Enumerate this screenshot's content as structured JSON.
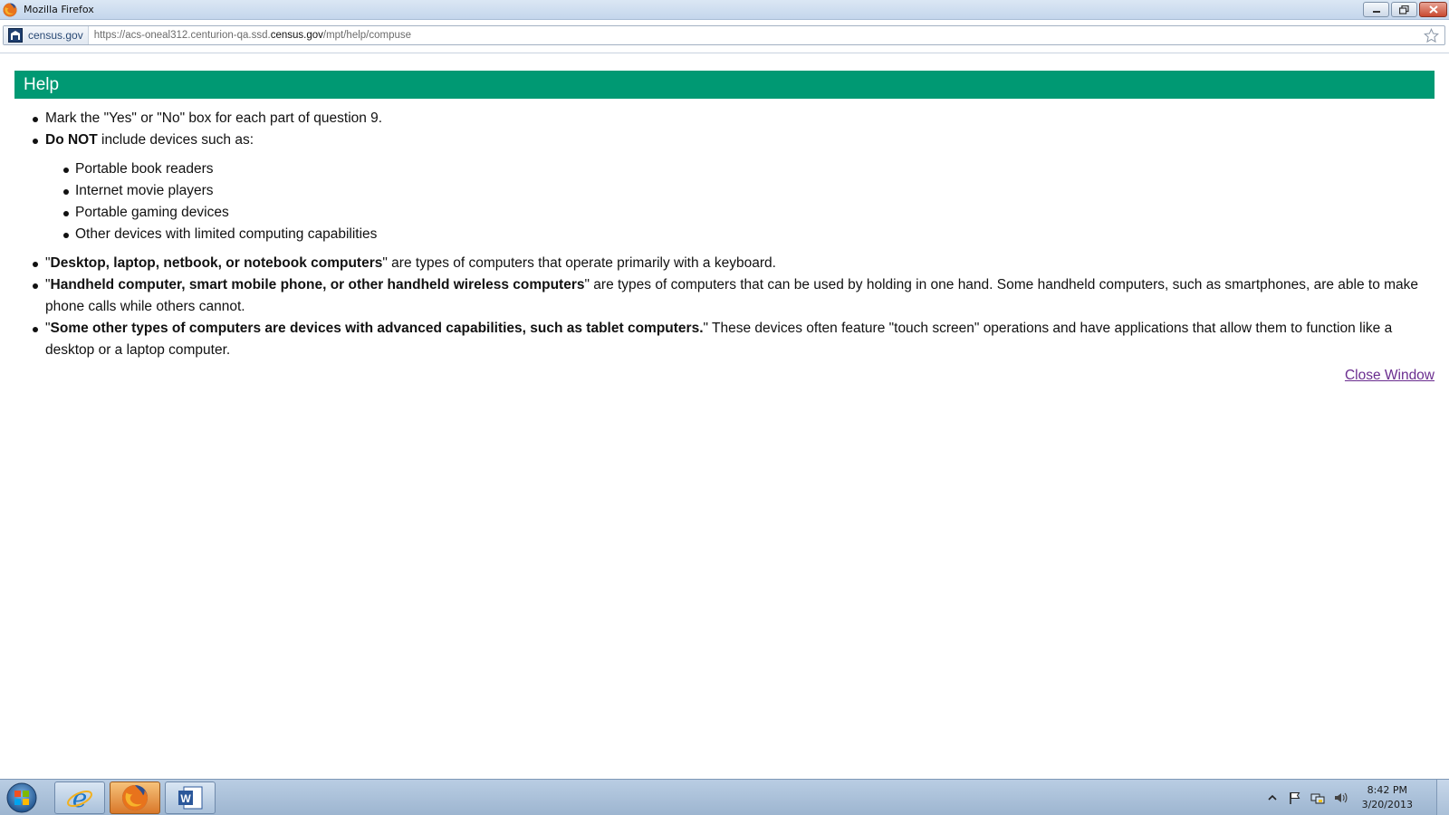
{
  "window": {
    "title": "Mozilla Firefox"
  },
  "address_bar": {
    "site_identity": "census.gov",
    "url_prefix": "https://acs-oneal312.centurion-qa.ssd.",
    "url_domain": "census.gov",
    "url_path": "/mpt/help/compuse"
  },
  "help": {
    "header": "Help",
    "item1": "Mark the \"Yes\" or \"No\" box for each part of question 9.",
    "item2_bold": "Do NOT",
    "item2_rest": " include devices such as:",
    "sub_items": [
      "Portable book readers",
      "Internet movie players",
      "Portable gaming devices",
      "Other devices with limited computing capabilities"
    ],
    "item3_quote_open": "\"",
    "item3_bold": "Desktop, laptop, netbook, or notebook computers",
    "item3_rest": "\" are types of computers that operate primarily with a keyboard.",
    "item4_quote_open": "\"",
    "item4_bold": "Handheld computer, smart mobile phone, or other handheld wireless computers",
    "item4_rest": "\" are types of computers that can be used by holding in one hand. Some handheld computers, such as smartphones, are able to make phone calls while others cannot.",
    "item5_quote_open": "\"",
    "item5_bold": "Some other types of computers are devices with advanced capabilities, such as tablet computers.",
    "item5_rest": "\" These devices often feature \"touch screen\" operations and have applications that allow them to function like a desktop or a laptop computer.",
    "close_link": "Close Window"
  },
  "taskbar": {
    "clock_time": "8:42 PM",
    "clock_date": "3/20/2013"
  },
  "colors": {
    "header_bg": "#009973",
    "link": "#6a2d8f"
  }
}
